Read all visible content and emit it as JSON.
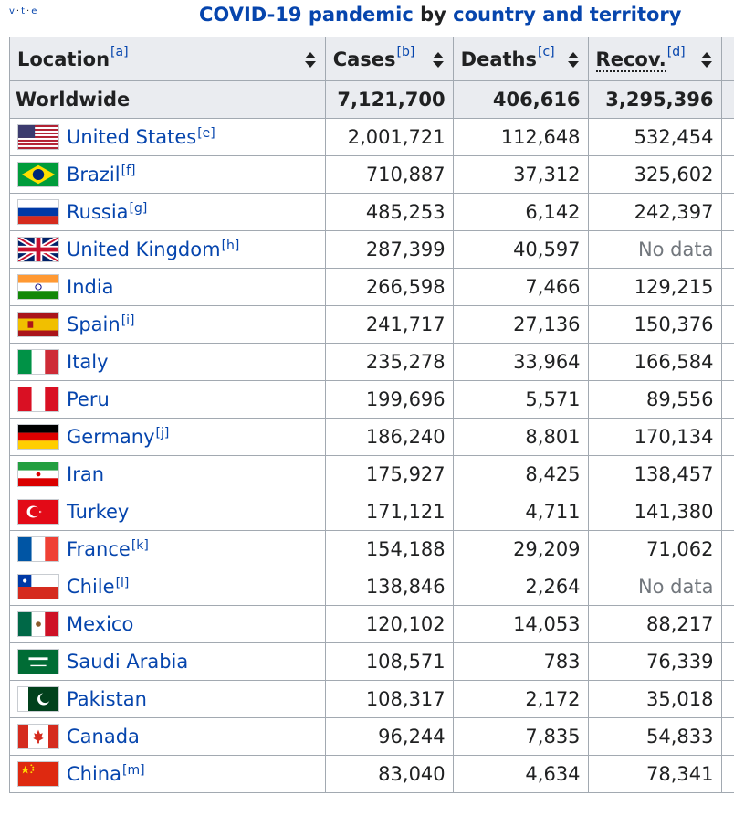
{
  "caption": {
    "vte": [
      "v",
      "t",
      "e"
    ],
    "title_link1": "COVID-19 pandemic",
    "title_mid": " by ",
    "title_link2": "country and territory"
  },
  "headers": {
    "location": "Location",
    "location_note": "[a]",
    "cases": "Cases",
    "cases_note": "[b]",
    "deaths": "Deaths",
    "deaths_note": "[c]",
    "recov": "Recov.",
    "recov_note": "[d]"
  },
  "worldwide": {
    "label": "Worldwide",
    "cases": "7,121,700",
    "deaths": "406,616",
    "recov": "3,295,396"
  },
  "rows": [
    {
      "name": "United States",
      "note": "[e]",
      "cases": "2,001,721",
      "deaths": "112,648",
      "recov": "532,454",
      "flag": "us-flag"
    },
    {
      "name": "Brazil",
      "note": "[f]",
      "cases": "710,887",
      "deaths": "37,312",
      "recov": "325,602",
      "flag": "brazil-flag"
    },
    {
      "name": "Russia",
      "note": "[g]",
      "cases": "485,253",
      "deaths": "6,142",
      "recov": "242,397",
      "flag": "russia-flag"
    },
    {
      "name": "United Kingdom",
      "note": "[h]",
      "cases": "287,399",
      "deaths": "40,597",
      "recov": "No data",
      "flag": "uk-flag"
    },
    {
      "name": "India",
      "note": "",
      "cases": "266,598",
      "deaths": "7,466",
      "recov": "129,215",
      "flag": "india-flag"
    },
    {
      "name": "Spain",
      "note": "[i]",
      "cases": "241,717",
      "deaths": "27,136",
      "recov": "150,376",
      "flag": "spain-flag"
    },
    {
      "name": "Italy",
      "note": "",
      "cases": "235,278",
      "deaths": "33,964",
      "recov": "166,584",
      "flag": "italy-flag"
    },
    {
      "name": "Peru",
      "note": "",
      "cases": "199,696",
      "deaths": "5,571",
      "recov": "89,556",
      "flag": "peru-flag"
    },
    {
      "name": "Germany",
      "note": "[j]",
      "cases": "186,240",
      "deaths": "8,801",
      "recov": "170,134",
      "flag": "germany-flag"
    },
    {
      "name": "Iran",
      "note": "",
      "cases": "175,927",
      "deaths": "8,425",
      "recov": "138,457",
      "flag": "iran-flag"
    },
    {
      "name": "Turkey",
      "note": "",
      "cases": "171,121",
      "deaths": "4,711",
      "recov": "141,380",
      "flag": "turkey-flag"
    },
    {
      "name": "France",
      "note": "[k]",
      "cases": "154,188",
      "deaths": "29,209",
      "recov": "71,062",
      "flag": "france-flag"
    },
    {
      "name": "Chile",
      "note": "[l]",
      "cases": "138,846",
      "deaths": "2,264",
      "recov": "No data",
      "flag": "chile-flag"
    },
    {
      "name": "Mexico",
      "note": "",
      "cases": "120,102",
      "deaths": "14,053",
      "recov": "88,217",
      "flag": "mexico-flag"
    },
    {
      "name": "Saudi Arabia",
      "note": "",
      "cases": "108,571",
      "deaths": "783",
      "recov": "76,339",
      "flag": "saudi-arabia-flag"
    },
    {
      "name": "Pakistan",
      "note": "",
      "cases": "108,317",
      "deaths": "2,172",
      "recov": "35,018",
      "flag": "pakistan-flag"
    },
    {
      "name": "Canada",
      "note": "",
      "cases": "96,244",
      "deaths": "7,835",
      "recov": "54,833",
      "flag": "canada-flag"
    },
    {
      "name": "China",
      "note": "[m]",
      "cases": "83,040",
      "deaths": "4,634",
      "recov": "78,341",
      "flag": "china-flag"
    }
  ],
  "colors": {
    "link": "#0645ad",
    "header_bg": "#eaecf0",
    "border": "#a2a9b1",
    "nodata": "#72777d"
  }
}
